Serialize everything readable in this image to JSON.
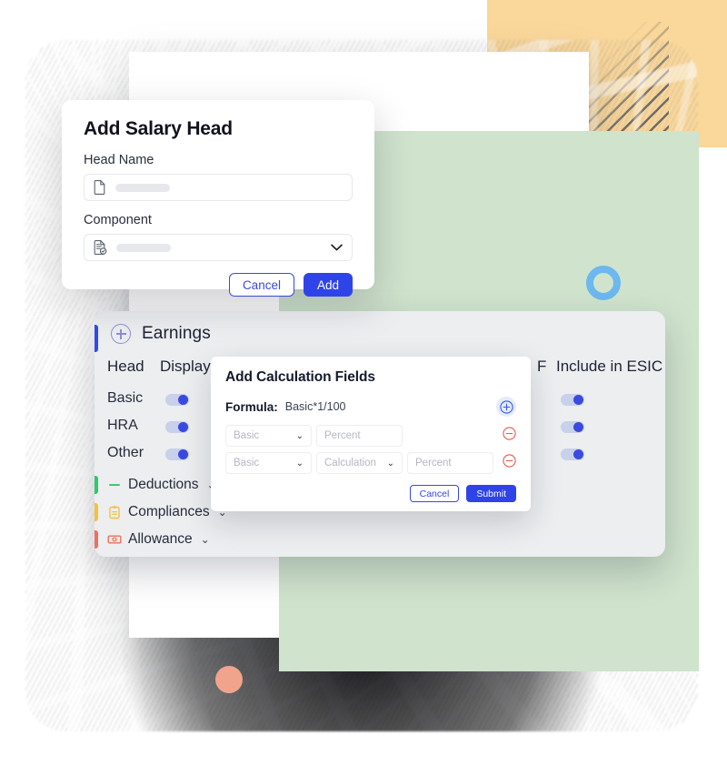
{
  "decorations": {
    "yellow_block_color": "#fad79a",
    "stripe_color": "#5d5d5d",
    "ring_color": "#6cb8ef",
    "dot_color": "#f0a48c",
    "green_canvas_color": "#cfe3cd",
    "accent_blue": "#2f44e8"
  },
  "salary_dialog": {
    "title": "Add Salary Head",
    "head_name_label": "Head Name",
    "head_name_value": "",
    "head_name_icon": "document-icon",
    "component_label": "Component",
    "component_value": "",
    "component_icon": "document-check-icon",
    "dropdown_icon": "chevron-down-icon",
    "cancel_label": "Cancel",
    "add_label": "Add"
  },
  "earnings_panel": {
    "title": "Earnings",
    "add_icon": "plus-circle-icon",
    "accent_color": "#2f4bf0",
    "columns": [
      {
        "label": "Head"
      },
      {
        "label": "Display"
      },
      {
        "label": "F"
      },
      {
        "label": "Include in ESIC"
      }
    ],
    "rows": [
      {
        "head": "Basic",
        "display_on": true,
        "esic_on": true
      },
      {
        "head": "HRA",
        "display_on": true,
        "esic_on": true
      },
      {
        "head": "Other",
        "display_on": true,
        "esic_on": true
      }
    ],
    "accordion": [
      {
        "label": "Deductions",
        "bar_color": "#2ec96a",
        "icon": "minus-icon",
        "icon_color": "#2ec96a",
        "chevron": "⌄"
      },
      {
        "label": "Compliances",
        "bar_color": "#f2c23e",
        "icon": "clipboard-icon",
        "icon_color": "#f2c23e",
        "chevron": "⌄"
      },
      {
        "label": "Allowance",
        "bar_color": "#ef6f5e",
        "icon": "money-icon",
        "icon_color": "#ef6f5e",
        "chevron": "⌄"
      }
    ]
  },
  "calc_dialog": {
    "title": "Add Calculation Fields",
    "formula_label": "Formula:",
    "formula_value": "Basic*1/100",
    "add_row_icon": "plus-circle-icon",
    "remove_row_icon": "minus-circle-icon",
    "rows": [
      {
        "fields": [
          {
            "kind": "select",
            "value": "Basic",
            "placeholder": "Basic"
          },
          {
            "kind": "text",
            "value": "",
            "placeholder": "Percent"
          }
        ]
      },
      {
        "fields": [
          {
            "kind": "select",
            "value": "Basic",
            "placeholder": "Basic"
          },
          {
            "kind": "select",
            "value": "Calculation",
            "placeholder": "Calculation"
          },
          {
            "kind": "text",
            "value": "",
            "placeholder": "Percent"
          }
        ]
      }
    ],
    "cancel_label": "Cancel",
    "submit_label": "Submit"
  }
}
